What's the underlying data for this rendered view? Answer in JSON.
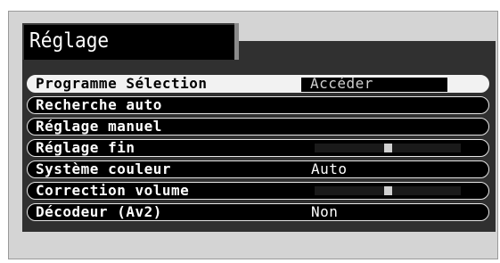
{
  "menu": {
    "title": "Réglage",
    "items": [
      {
        "label": "Programme Sélection",
        "value": "Accéder",
        "kind": "boxed",
        "selected": true
      },
      {
        "label": "Recherche auto",
        "value": "",
        "kind": "none",
        "selected": false
      },
      {
        "label": "Réglage manuel",
        "value": "",
        "kind": "none",
        "selected": false
      },
      {
        "label": "Réglage fin",
        "kind": "slider",
        "level": 0.5,
        "selected": false
      },
      {
        "label": "Système couleur",
        "value": "Auto",
        "kind": "text",
        "selected": false
      },
      {
        "label": "Correction volume",
        "kind": "slider",
        "level": 0.5,
        "selected": false
      },
      {
        "label": "Décodeur (Av2)",
        "value": "Non",
        "kind": "text",
        "selected": false
      }
    ]
  }
}
